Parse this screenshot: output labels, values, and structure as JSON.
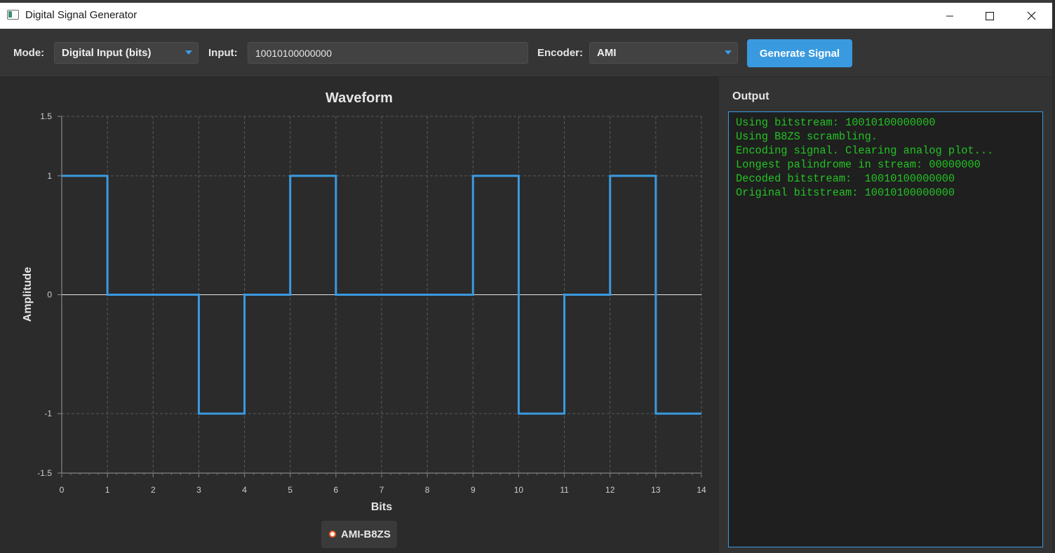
{
  "window": {
    "title": "Digital Signal Generator"
  },
  "toolbar": {
    "mode_label": "Mode:",
    "mode_value": "Digital Input (bits)",
    "input_label": "Input:",
    "input_value": "10010100000000",
    "encoder_label": "Encoder:",
    "encoder_value": "AMI",
    "generate_label": "Generate Signal"
  },
  "colors": {
    "accent": "#3a9ae0",
    "series": "#3a9ae0",
    "legend_marker": "#f15a24",
    "output_text": "#22c323"
  },
  "chart_data": {
    "type": "line",
    "step": true,
    "title": "Waveform",
    "xlabel": "Bits",
    "ylabel": "Amplitude",
    "xlim": [
      0,
      14
    ],
    "ylim": [
      -1.5,
      1.5
    ],
    "x_ticks": [
      "0",
      "1",
      "2",
      "3",
      "4",
      "5",
      "6",
      "7",
      "8",
      "9",
      "10",
      "11",
      "12",
      "13",
      "14"
    ],
    "y_ticks": [
      "1.5",
      "1",
      "0",
      "-1",
      "-1.5"
    ],
    "grid": true,
    "legend_position": "bottom-center",
    "series": [
      {
        "name": "AMI-B8ZS",
        "x": [
          0,
          1,
          2,
          3,
          4,
          5,
          6,
          7,
          8,
          9,
          10,
          11,
          12,
          13
        ],
        "values": [
          1,
          0,
          0,
          -1,
          0,
          1,
          0,
          0,
          0,
          1,
          -1,
          0,
          1,
          -1
        ]
      }
    ]
  },
  "output": {
    "label": "Output",
    "lines": [
      "Using bitstream: 10010100000000",
      "Using B8ZS scrambling.",
      "Encoding signal. Clearing analog plot...",
      "Longest palindrome in stream: 00000000",
      "Decoded bitstream:  10010100000000",
      "Original bitstream: 10010100000000"
    ]
  }
}
